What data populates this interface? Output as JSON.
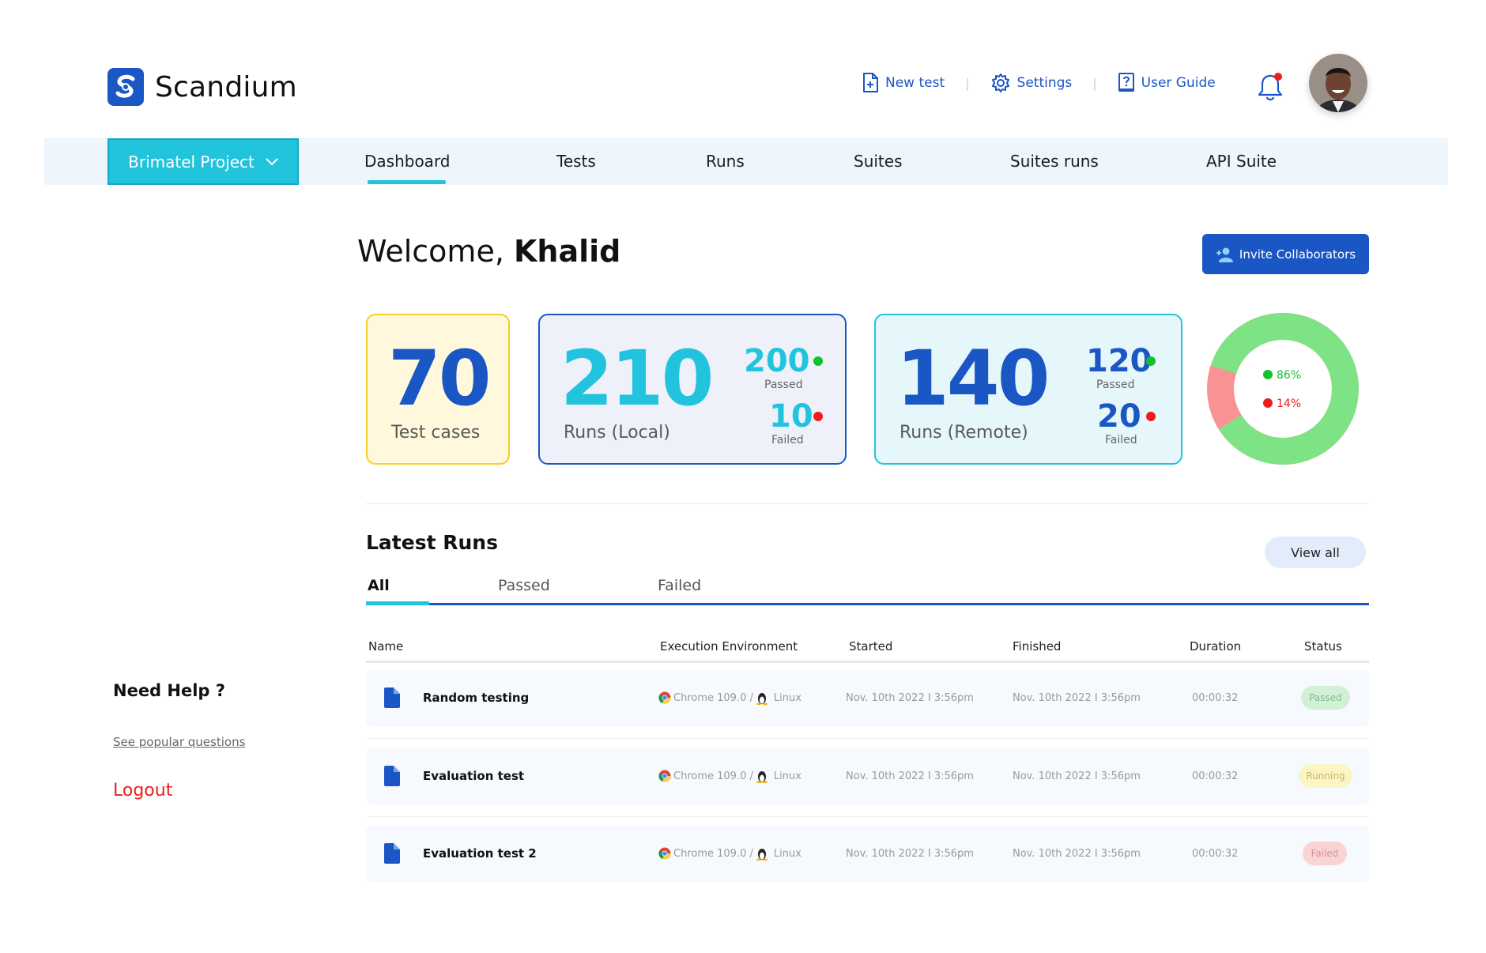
{
  "header": {
    "brand": "Scandium",
    "links": [
      {
        "label": "New test",
        "icon": "new-file-icon"
      },
      {
        "label": "Settings",
        "icon": "gear-icon"
      },
      {
        "label": "User Guide",
        "icon": "question-book-icon"
      }
    ]
  },
  "nav": {
    "project": "Brimatel Project",
    "tabs": [
      "Dashboard",
      "Tests",
      "Runs",
      "Suites",
      "Suites runs",
      "API Suite"
    ],
    "active_tab": "Dashboard"
  },
  "welcome": {
    "greeting": "Welcome, ",
    "name": "Khalid"
  },
  "invite_label": "Invite Collaborators",
  "stats": {
    "test_cases": {
      "value": "70",
      "label": "Test cases"
    },
    "local": {
      "value": "210",
      "label": "Runs (Local)",
      "passed": "200",
      "passed_label": "Passed",
      "failed": "10",
      "failed_label": "Failed"
    },
    "remote": {
      "value": "140",
      "label": "Runs (Remote)",
      "passed": "120",
      "passed_label": "Passed",
      "failed": "20",
      "failed_label": "Failed"
    }
  },
  "donut": {
    "passed_pct": 86,
    "failed_pct": 14,
    "passed_label": "86%",
    "failed_label": "14%"
  },
  "latest_runs": {
    "title": "Latest Runs",
    "view_all": "View all",
    "filters": [
      "All",
      "Passed",
      "Failed"
    ],
    "active_filter": "All",
    "columns": [
      "Name",
      "Execution Environment",
      "Started",
      "Finished",
      "Duration",
      "Status"
    ],
    "rows": [
      {
        "name": "Random testing",
        "browser": "Chrome 109.0 /",
        "os": "Linux",
        "started": "Nov. 10th 2022  I  3:56pm",
        "finished": "Nov. 10th 2022  I  3:56pm",
        "duration": "00:00:32",
        "status": "Passed"
      },
      {
        "name": "Evaluation test",
        "browser": "Chrome 109.0 /",
        "os": "Linux",
        "started": "Nov. 10th 2022  I  3:56pm",
        "finished": "Nov. 10th 2022  I  3:56pm",
        "duration": "00:00:32",
        "status": "Running"
      },
      {
        "name": "Evaluation test 2",
        "browser": "Chrome 109.0 /",
        "os": "Linux",
        "started": "Nov. 10th 2022  I  3:56pm",
        "finished": "Nov. 10th 2022  I  3:56pm",
        "duration": "00:00:32",
        "status": "Failed"
      }
    ]
  },
  "sidebar": {
    "need_help": "Need Help ?",
    "popular": "See popular questions",
    "logout": "Logout"
  },
  "colors": {
    "primary": "#1a56c4",
    "accent": "#22c3dc",
    "passed": "#12c12e",
    "failed": "#ee1c1c",
    "donut_passed": "#7de384",
    "donut_failed": "#f89394"
  }
}
